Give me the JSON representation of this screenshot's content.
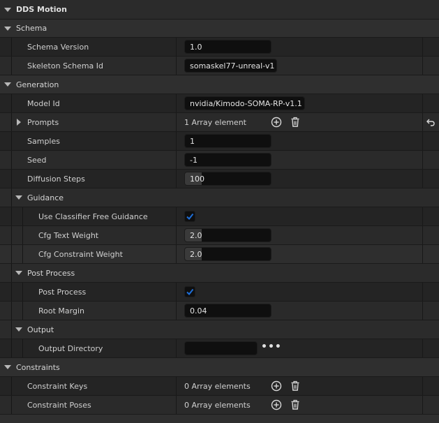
{
  "header": {
    "title": "DDS Motion"
  },
  "schema": {
    "category": "Schema",
    "schema_version": {
      "label": "Schema Version",
      "value": "1.0"
    },
    "skeleton_schema_id": {
      "label": "Skeleton Schema Id",
      "value": "somaskel77-unreal-v1"
    }
  },
  "generation": {
    "category": "Generation",
    "model_id": {
      "label": "Model Id",
      "value": "nvidia/Kimodo-SOMA-RP-v1.1"
    },
    "prompts": {
      "label": "Prompts",
      "value": "1 Array element"
    },
    "samples": {
      "label": "Samples",
      "value": "1"
    },
    "seed": {
      "label": "Seed",
      "value": "-1"
    },
    "diffusion_steps": {
      "label": "Diffusion Steps",
      "value": "100"
    }
  },
  "guidance": {
    "category": "Guidance",
    "use_cfg": {
      "label": "Use Classifier Free Guidance",
      "checked": true
    },
    "cfg_text_weight": {
      "label": "Cfg Text Weight",
      "value": "2.0"
    },
    "cfg_constraint_weight": {
      "label": "Cfg Constraint Weight",
      "value": "2.0"
    }
  },
  "post_process": {
    "category": "Post Process",
    "post_process": {
      "label": "Post Process",
      "checked": true
    },
    "root_margin": {
      "label": "Root Margin",
      "value": "0.04"
    }
  },
  "output": {
    "category": "Output",
    "output_directory": {
      "label": "Output Directory",
      "value": ""
    }
  },
  "constraints": {
    "category": "Constraints",
    "constraint_keys": {
      "label": "Constraint Keys",
      "value": "0 Array elements"
    },
    "constraint_poses": {
      "label": "Constraint Poses",
      "value": "0 Array elements"
    }
  },
  "colors": {
    "accent": "#1e6fd9",
    "background": "#242424",
    "category": "#2f2f2f"
  },
  "icons": [
    "collapse-arrow-icon",
    "expand-arrow-icon",
    "add-element-icon",
    "delete-elements-icon",
    "reset-to-default-icon",
    "browse-dots-icon",
    "checkmark-icon"
  ]
}
